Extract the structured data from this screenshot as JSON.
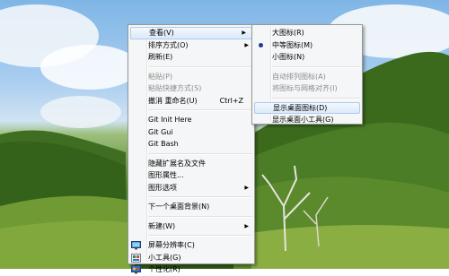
{
  "main_menu": {
    "items": [
      {
        "label": "查看(V)",
        "submenu": true,
        "state": "highlighted"
      },
      {
        "label": "排序方式(O)",
        "submenu": true
      },
      {
        "label": "刷新(E)"
      },
      {
        "label": "粘贴(P)",
        "disabled": true
      },
      {
        "label": "粘贴快捷方式(S)",
        "disabled": true
      },
      {
        "label": "撤消 重命名(U)",
        "shortcut": "Ctrl+Z"
      },
      {
        "label": "Git Init Here"
      },
      {
        "label": "Git Gui"
      },
      {
        "label": "Git Bash"
      },
      {
        "label": "隐藏扩展名及文件"
      },
      {
        "label": "图形属性..."
      },
      {
        "label": "图形选项",
        "submenu": true
      },
      {
        "label": "下一个桌面背景(N)"
      },
      {
        "label": "新建(W)",
        "submenu": true
      },
      {
        "label": "屏幕分辨率(C)",
        "icon": "screen-resolution-icon"
      },
      {
        "label": "小工具(G)",
        "icon": "gadgets-icon"
      },
      {
        "label": "个性化(R)",
        "icon": "personalize-icon"
      }
    ]
  },
  "view_submenu": {
    "items": [
      {
        "label": "大图标(R)"
      },
      {
        "label": "中等图标(M)",
        "selected": true
      },
      {
        "label": "小图标(N)"
      },
      {
        "label": "自动排列图标(A)",
        "disabled": true
      },
      {
        "label": "将图标与网格对齐(I)",
        "disabled": true
      },
      {
        "label": "显示桌面图标(D)",
        "state": "highlighted"
      },
      {
        "label": "显示桌面小工具(G)"
      }
    ]
  },
  "colors": {
    "menu_background": "#f5f6f7",
    "highlight": "#dbe9fa",
    "disabled_text": "#8d8d8d",
    "radio_bullet": "#1c3d8c"
  }
}
